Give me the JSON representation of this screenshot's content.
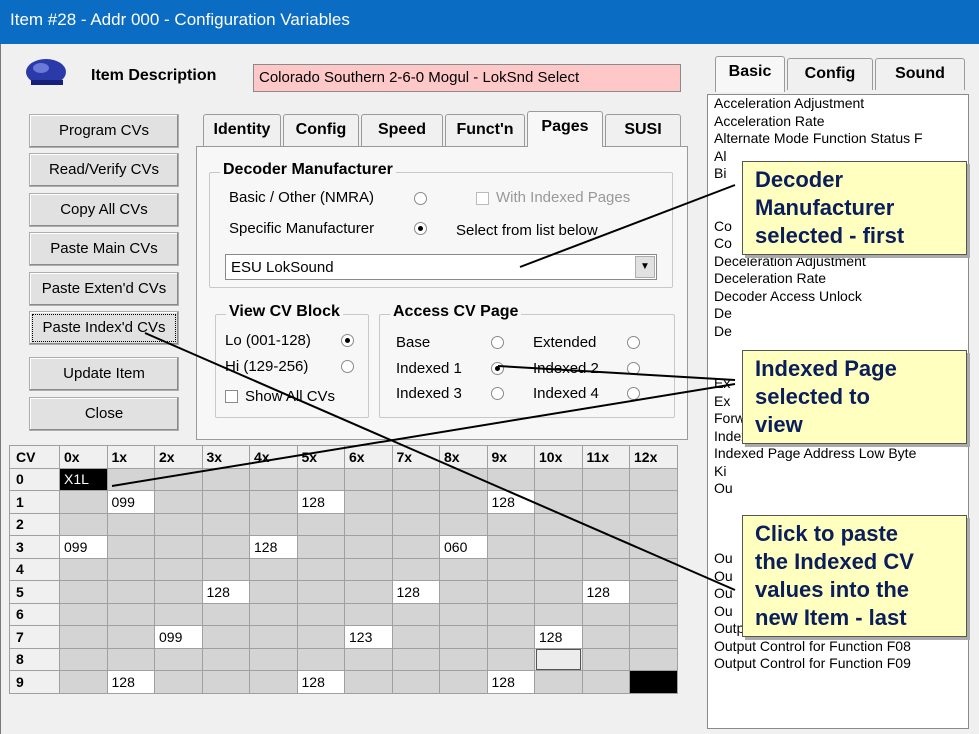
{
  "window": {
    "title": "Item #28 - Addr 000 - Configuration Variables"
  },
  "item": {
    "description_label": "Item Description",
    "description_value": "Colorado Southern 2-6-0 Mogul - LokSnd Select"
  },
  "buttons": {
    "program": "Program CVs",
    "read_verify": "Read/Verify CVs",
    "copy_all": "Copy All CVs",
    "paste_main": "Paste Main CVs",
    "paste_extend": "Paste Exten'd CVs",
    "paste_index": "Paste Index'd CVs",
    "update_item": "Update Item",
    "close": "Close"
  },
  "tabs": [
    "Identity",
    "Config",
    "Speed",
    "Funct'n",
    "Pages",
    "SUSI"
  ],
  "right_tabs": [
    "Basic",
    "Config",
    "Sound"
  ],
  "decoder_manufacturer": {
    "title": "Decoder Manufacturer",
    "basic_label": "Basic / Other (NMRA)",
    "with_indexed_label": "With Indexed Pages",
    "specific_label": "Specific Manufacturer",
    "select_hint": "Select from list below",
    "selected": "ESU LokSound"
  },
  "view_cv_block": {
    "title": "View CV Block",
    "lo": "Lo (001-128)",
    "hi": "Hi (129-256)",
    "show_all": "Show All CVs"
  },
  "access_cv_page": {
    "title": "Access CV Page",
    "base": "Base",
    "extended": "Extended",
    "indexed1": "Indexed 1",
    "indexed2": "Indexed 2",
    "indexed3": "Indexed 3",
    "indexed4": "Indexed 4"
  },
  "grid": {
    "corner": "CV",
    "col_headers": [
      "0x",
      "1x",
      "2x",
      "3x",
      "4x",
      "5x",
      "6x",
      "7x",
      "8x",
      "9x",
      "10x",
      "11x",
      "12x"
    ],
    "rows": [
      {
        "label": "0",
        "cells": [
          "X1L",
          "",
          "",
          "",
          "",
          "",
          "",
          "",
          "",
          "",
          "",
          "",
          ""
        ]
      },
      {
        "label": "1",
        "cells": [
          "",
          "099",
          "",
          "",
          "",
          "128",
          "",
          "",
          "",
          "128",
          "",
          "",
          ""
        ]
      },
      {
        "label": "2",
        "cells": [
          "",
          "",
          "",
          "",
          "",
          "",
          "",
          "",
          "",
          "",
          "",
          "",
          ""
        ]
      },
      {
        "label": "3",
        "cells": [
          "099",
          "",
          "",
          "",
          "128",
          "",
          "",
          "",
          "060",
          "",
          "",
          "",
          ""
        ]
      },
      {
        "label": "4",
        "cells": [
          "",
          "",
          "",
          "",
          "",
          "",
          "",
          "",
          "",
          "",
          "",
          "",
          ""
        ]
      },
      {
        "label": "5",
        "cells": [
          "",
          "",
          "",
          "128",
          "",
          "",
          "",
          "128",
          "",
          "",
          "",
          "128",
          ""
        ]
      },
      {
        "label": "6",
        "cells": [
          "",
          "",
          "",
          "",
          "",
          "",
          "",
          "",
          "",
          "",
          "",
          "",
          ""
        ]
      },
      {
        "label": "7",
        "cells": [
          "",
          "",
          "099",
          "",
          "",
          "",
          "123",
          "",
          "",
          "",
          "128",
          "",
          ""
        ]
      },
      {
        "label": "8",
        "cells": [
          "",
          "",
          "",
          "",
          "",
          "",
          "",
          "",
          "",
          "",
          "",
          "",
          ""
        ]
      },
      {
        "label": "9",
        "cells": [
          "",
          "128",
          "",
          "",
          "",
          "128",
          "",
          "",
          "",
          "128",
          "",
          "",
          ""
        ]
      }
    ]
  },
  "cv_list": [
    "Acceleration Adjustment",
    "Acceleration Rate",
    "Alternate Mode Function Status F",
    "Al",
    "Bi",
    "",
    "",
    "Co",
    "Co",
    "Deceleration Adjustment",
    "Deceleration Rate",
    "Decoder Access Unlock",
    "De",
    "De",
    "",
    "",
    "Ex",
    "Ex",
    "Forward Trim",
    "Indexed Page Address High Byte",
    "Indexed Page Address Low Byte",
    "Ki",
    "Ou",
    "",
    "",
    "",
    "Ou",
    "Ou",
    "Ou",
    "Ou",
    "Output Control for Function F07",
    "Output Control for Function F08",
    "Output Control for Function F09"
  ],
  "callouts": {
    "first": [
      "Decoder",
      "Manufacturer",
      "selected - first"
    ],
    "second": [
      "Indexed Page",
      "selected to",
      "view"
    ],
    "third": [
      "Click to paste",
      "the Indexed CV",
      "values into the",
      "new Item - last"
    ]
  }
}
